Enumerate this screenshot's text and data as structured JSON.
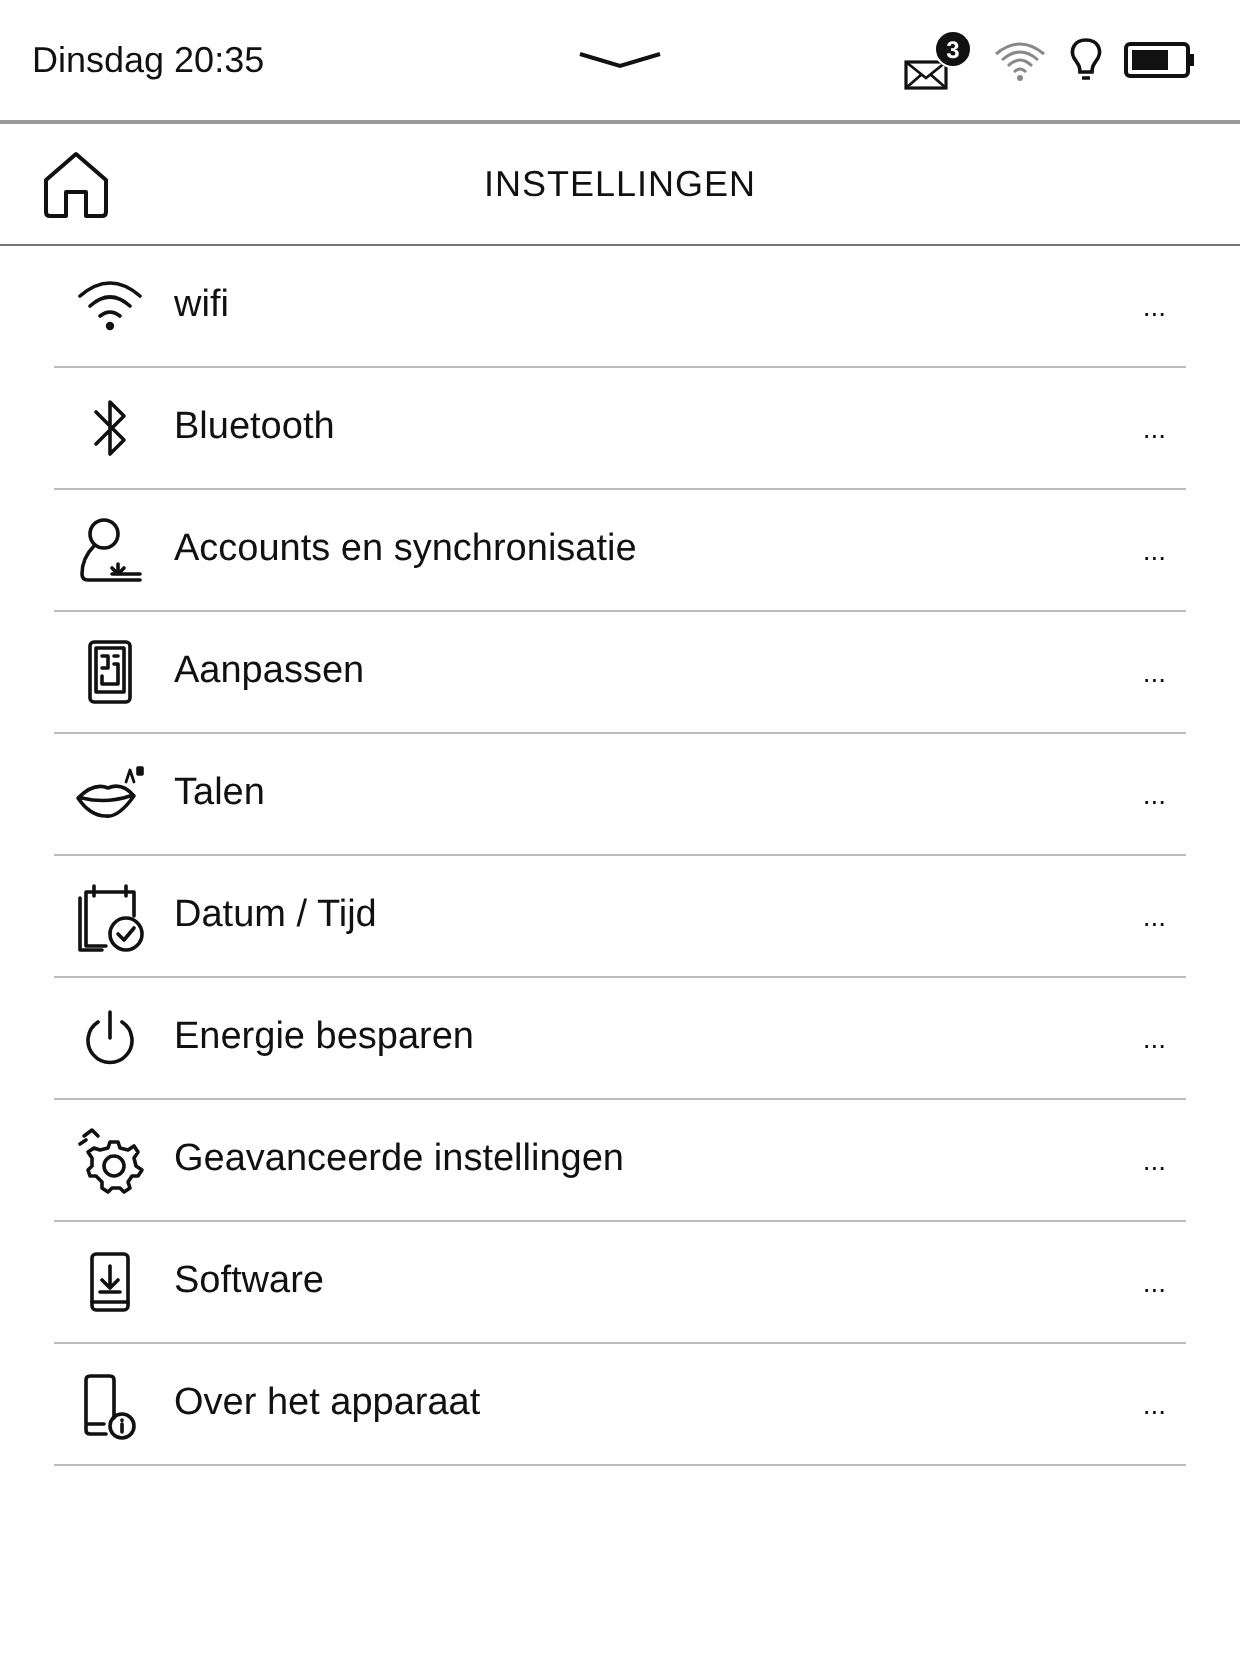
{
  "status_bar": {
    "datetime": "Dinsdag 20:35",
    "mail_count": "3"
  },
  "header": {
    "title": "INSTELLINGEN"
  },
  "items": [
    {
      "kind": "wifi",
      "label": "wifi",
      "more": "..."
    },
    {
      "kind": "bluetooth",
      "label": "Bluetooth",
      "more": "..."
    },
    {
      "kind": "accounts",
      "label": "Accounts en synchronisatie",
      "more": "..."
    },
    {
      "kind": "customize",
      "label": "Aanpassen",
      "more": "..."
    },
    {
      "kind": "languages",
      "label": "Talen",
      "more": "..."
    },
    {
      "kind": "datetime",
      "label": "Datum / Tijd",
      "more": "..."
    },
    {
      "kind": "power",
      "label": "Energie besparen",
      "more": "..."
    },
    {
      "kind": "advanced",
      "label": "Geavanceerde instellingen",
      "more": "..."
    },
    {
      "kind": "software",
      "label": "Software",
      "more": "..."
    },
    {
      "kind": "about",
      "label": "Over het apparaat",
      "more": "..."
    }
  ]
}
